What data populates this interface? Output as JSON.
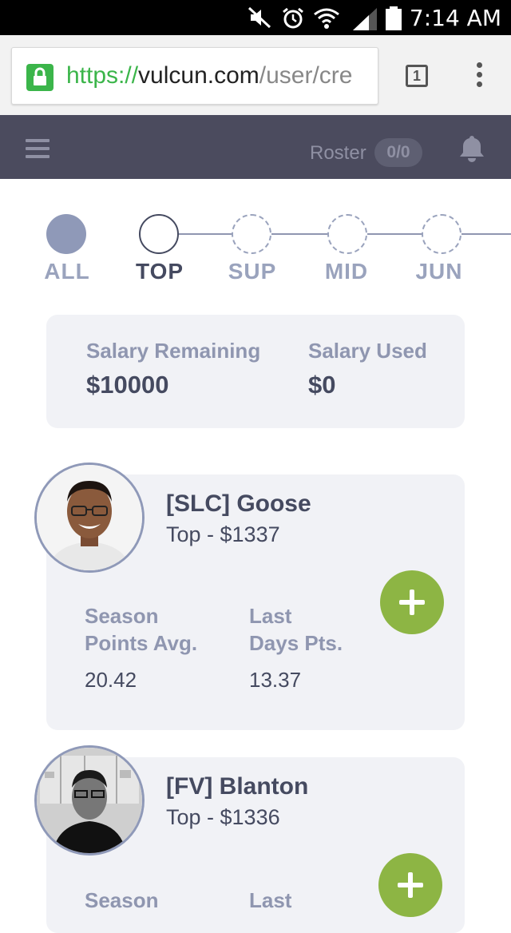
{
  "status_bar": {
    "time": "7:14 AM"
  },
  "browser": {
    "url_scheme": "https://",
    "url_host": "vulcun.com",
    "url_path": "/user/cre",
    "tab_count": "1"
  },
  "header": {
    "roster_label": "Roster",
    "roster_count": "0/0"
  },
  "positions": [
    "ALL",
    "TOP",
    "SUP",
    "MID",
    "JUN"
  ],
  "salary": {
    "remaining_label": "Salary Remaining",
    "remaining_value": "$10000",
    "used_label": "Salary Used",
    "used_value": "$0"
  },
  "players": [
    {
      "name": "[SLC] Goose",
      "role": "Top - $1337",
      "stat1_label_a": "Season",
      "stat1_label_b": "Points Avg.",
      "stat1_value": "20.42",
      "stat2_label_a": "Last",
      "stat2_label_b": "Days Pts.",
      "stat2_value": "13.37"
    },
    {
      "name": "[FV] Blanton",
      "role": "Top - $1336",
      "stat1_label_a": "Season",
      "stat2_label_a": "Last"
    }
  ],
  "colors": {
    "header_bg": "#4b4b5e",
    "card_bg": "#f1f2f6",
    "add_button": "#8db544",
    "text_dark": "#454a60",
    "text_muted": "#8f96b0"
  }
}
